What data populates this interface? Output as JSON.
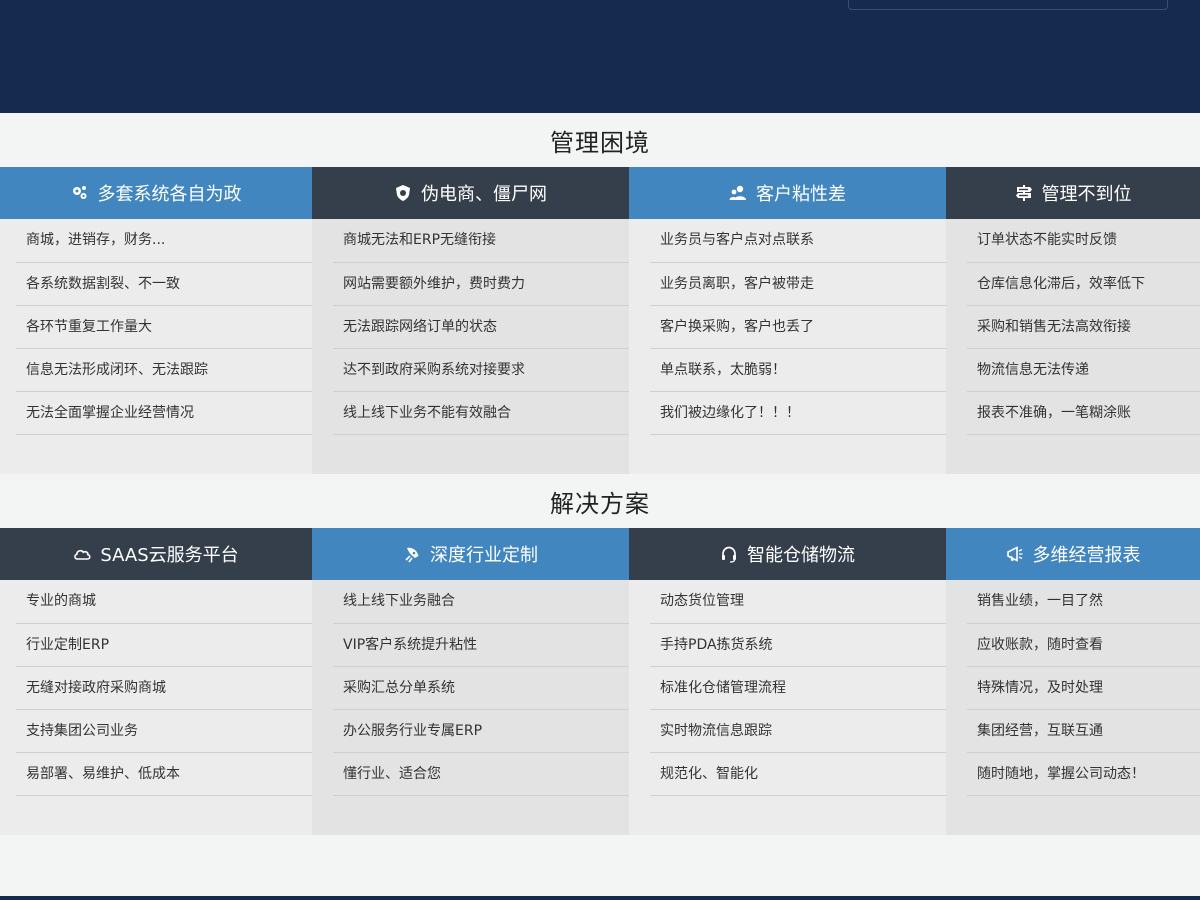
{
  "problems": {
    "title": "管理困境",
    "columns": [
      {
        "header": "多套系统各自为政",
        "icon": "gears-icon",
        "items": [
          "商城，进销存，财务...",
          "各系统数据割裂、不一致",
          "各环节重复工作量大",
          "信息无法形成闭环、无法跟踪",
          "无法全面掌握企业经营情况"
        ]
      },
      {
        "header": "伪电商、僵尸网",
        "icon": "shield-icon",
        "items": [
          "商城无法和ERP无缝衔接",
          "网站需要额外维护，费时费力",
          "无法跟踪网络订单的状态",
          "达不到政府采购系统对接要求",
          "线上线下业务不能有效融合"
        ]
      },
      {
        "header": "客户粘性差",
        "icon": "users-icon",
        "items": [
          "业务员与客户点对点联系",
          "业务员离职，客户被带走",
          "客户换采购，客户也丢了",
          "单点联系，太脆弱！",
          "我们被边缘化了！！！"
        ]
      },
      {
        "header": "管理不到位",
        "icon": "signpost-icon",
        "items": [
          "订单状态不能实时反馈",
          "仓库信息化滞后，效率低下",
          "采购和销售无法高效衔接",
          "物流信息无法传递",
          "报表不准确，一笔糊涂账"
        ]
      }
    ]
  },
  "solutions": {
    "title": "解决方案",
    "columns": [
      {
        "header": "SAAS云服务平台",
        "icon": "cloud-icon",
        "items": [
          "专业的商城",
          "行业定制ERP",
          "无缝对接政府采购商城",
          "支持集团公司业务",
          "易部署、易维护、低成本"
        ]
      },
      {
        "header": "深度行业定制",
        "icon": "rocket-icon",
        "items": [
          "线上线下业务融合",
          "VIP客户系统提升粘性",
          "采购汇总分单系统",
          "办公服务行业专属ERP",
          "懂行业、适合您"
        ]
      },
      {
        "header": "智能仓储物流",
        "icon": "headset-icon",
        "items": [
          "动态货位管理",
          "手持PDA拣货系统",
          "标准化仓储管理流程",
          "实时物流信息跟踪",
          "规范化、智能化"
        ]
      },
      {
        "header": "多维经营报表",
        "icon": "megaphone-icon",
        "items": [
          "销售业绩，一目了然",
          "应收账款，随时查看",
          "特殊情况，及时处理",
          "集团经营，互联互通",
          "随时随地，掌握公司动态！"
        ]
      }
    ]
  }
}
